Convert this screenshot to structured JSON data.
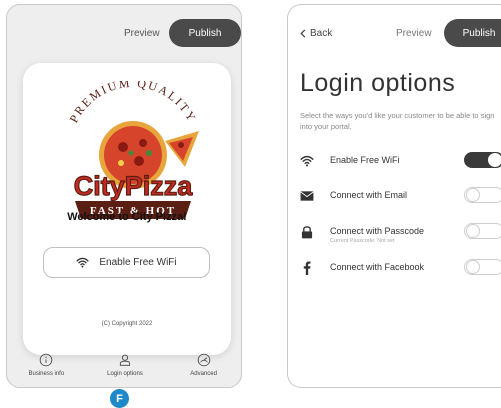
{
  "left_screen": {
    "header": {
      "preview_label": "Preview",
      "publish_label": "Publish"
    },
    "logo": {
      "top_text": "PREMIUM QUALITY",
      "brand": "CityPizza",
      "bottom_text": "FAST & HOT"
    },
    "welcome": "Welcome to City Pizza!",
    "wifi_button_label": "Enable Free WiFi",
    "copyright": "(C) Copyright 2022",
    "tabs": [
      {
        "label": "Business info",
        "icon": "info-icon"
      },
      {
        "label": "Login options",
        "icon": "user-icon"
      },
      {
        "label": "Advanced",
        "icon": "gauge-icon"
      }
    ],
    "badge": "F"
  },
  "right_screen": {
    "header": {
      "back_label": "Back",
      "preview_label": "Preview",
      "publish_label": "Publish"
    },
    "title": "Login options",
    "description": "Select the ways you'd like your customer to be able to sign into your portal.",
    "options": [
      {
        "label": "Enable Free WiFi",
        "icon": "wifi-icon",
        "enabled": true,
        "sublabel": ""
      },
      {
        "label": "Connect with Email",
        "icon": "email-icon",
        "enabled": false,
        "sublabel": ""
      },
      {
        "label": "Connect with Passcode",
        "icon": "lock-icon",
        "enabled": false,
        "sublabel": "Current Passcode: Not set"
      },
      {
        "label": "Connect with Facebook",
        "icon": "facebook-icon",
        "enabled": false,
        "sublabel": ""
      }
    ]
  },
  "colors": {
    "dark_button": "#4a4a4a",
    "badge_blue": "#1e88c8",
    "toggle_on": "#3a3a3a",
    "logo_red": "#c62b21",
    "logo_dark": "#5a1e12"
  }
}
